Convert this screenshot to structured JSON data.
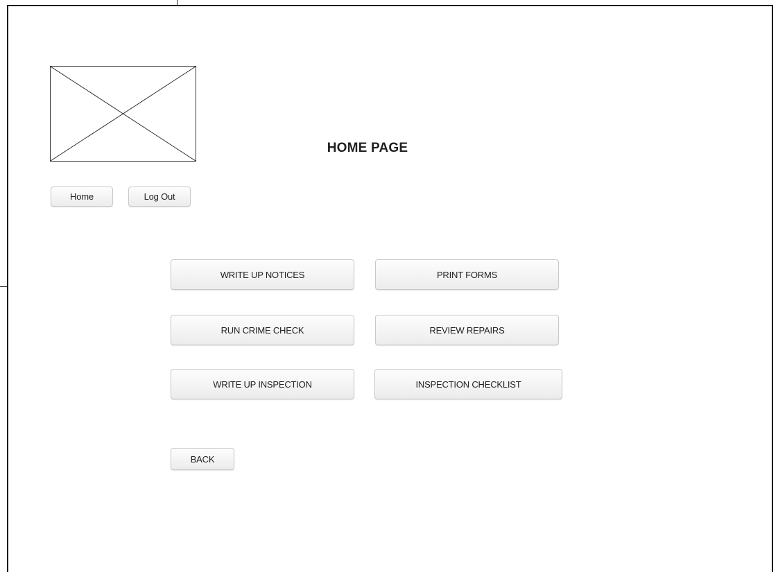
{
  "header": {
    "title": "HOME PAGE",
    "logo_icon": "image-placeholder-icon"
  },
  "nav": {
    "home_label": "Home",
    "logout_label": "Log Out"
  },
  "actions": [
    {
      "label": "WRITE UP NOTICES"
    },
    {
      "label": "PRINT FORMS"
    },
    {
      "label": "RUN CRIME CHECK"
    },
    {
      "label": "REVIEW REPAIRS"
    },
    {
      "label": "WRITE UP INSPECTION"
    },
    {
      "label": "INSPECTION CHECKLIST"
    }
  ],
  "footer": {
    "back_label": "BACK"
  },
  "colors": {
    "frame_border": "#1a1a1a",
    "button_border": "#c9c9c9",
    "text": "#222222"
  }
}
